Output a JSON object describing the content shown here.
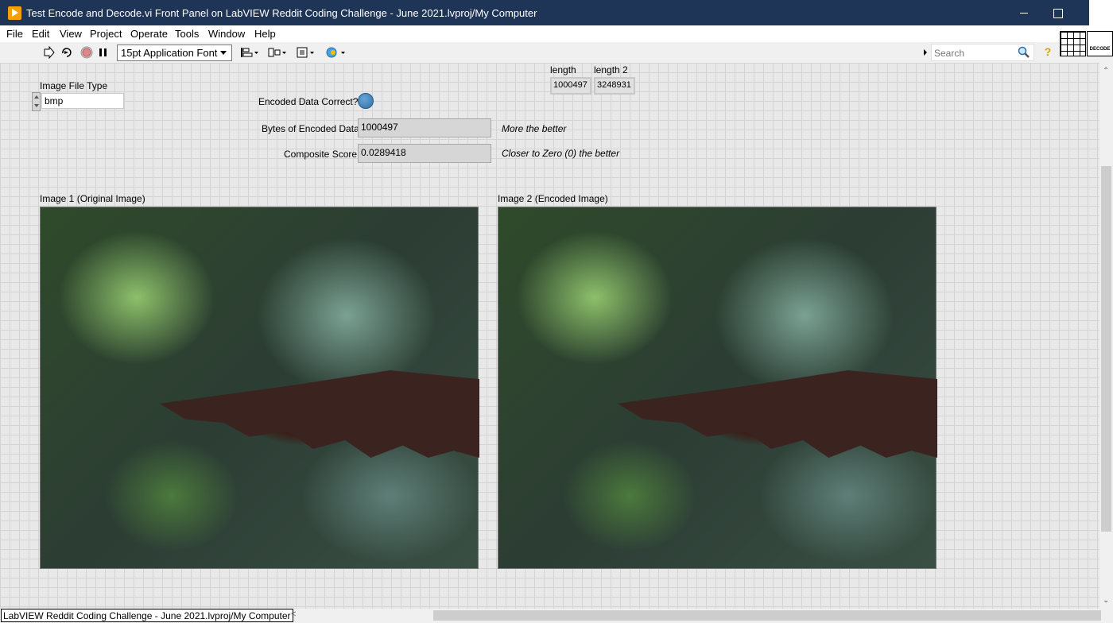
{
  "window": {
    "title": "Test Encode and Decode.vi Front Panel on LabVIEW Reddit Coding Challenge - June 2021.lvproj/My Computer",
    "close_glyph": "✕"
  },
  "menu": [
    "File",
    "Edit",
    "View",
    "Project",
    "Operate",
    "Tools",
    "Window",
    "Help"
  ],
  "toolbar": {
    "font_select": "15pt Application Font",
    "search_placeholder": "Search",
    "help_glyph": "?",
    "vi_icon_text": "DECODE"
  },
  "controls": {
    "image_file_type": {
      "label": "Image File Type",
      "value": "bmp"
    },
    "encoded_correct": {
      "label": "Encoded Data Correct?",
      "state": true,
      "color": "#3a7bbd"
    },
    "bytes_encoded": {
      "label": "Bytes of Encoded Data",
      "value": "1000497",
      "comment": "More the better"
    },
    "composite_score": {
      "label": "Composite Score",
      "value": "0.0289418",
      "comment": "Closer to Zero (0) the better"
    },
    "length": {
      "label": "length",
      "value": "1000497"
    },
    "length2": {
      "label": "length 2",
      "value": "3248931"
    }
  },
  "images": {
    "image1_label": "Image 1 (Original Image)",
    "image2_label": "Image 2 (Encoded Image)"
  },
  "status_bar": {
    "project": "LabVIEW Reddit Coding Challenge - June 2021.lvproj/My Computer"
  }
}
